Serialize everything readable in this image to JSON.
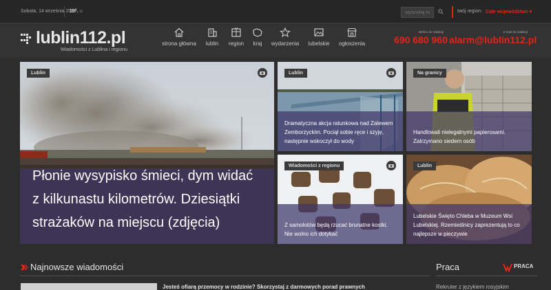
{
  "topbar": {
    "date": "Sobota, 14 września 2019",
    "temperature": "19°.",
    "search_placeholder": "wyszukaj na",
    "region_label": "twój region:",
    "region_value": "Całe województwo ▾"
  },
  "header": {
    "logo": "lublin112.pl",
    "tagline": "Wiadomości z Lublina i regionu",
    "nav": [
      {
        "label": "strona główna",
        "icon": "home-icon"
      },
      {
        "label": "lublin",
        "icon": "building-icon"
      },
      {
        "label": "region",
        "icon": "map-grid-icon"
      },
      {
        "label": "kraj",
        "icon": "country-icon"
      },
      {
        "label": "wydarzenia",
        "icon": "star-icon"
      },
      {
        "label": "lubelskie",
        "icon": "landscape-icon"
      },
      {
        "label": "ogłoszenia",
        "icon": "shop-icon"
      }
    ],
    "phone_label": "telefon do redakcji",
    "phone": "690 680 960",
    "email_label": "e-mail do redakcji",
    "email": "alarm@lublin112.pl"
  },
  "featured": {
    "tag": "Lublin",
    "title": "Płonie wysypisko śmieci, dym widać z kilkunastu kilometrów. Dziesiątki strażaków na miejscu (zdjęcia)"
  },
  "tiles": [
    {
      "tag": "Lublin",
      "title": "Dramatyczna akcja ratunkowa nad Zalewem Zemborzyckim. Pociął sobie ręce i szyję, następnie wskoczył do wody"
    },
    {
      "tag": "Na granicy",
      "title": "Handlowali nielegalnymi papierosami. Zatrzymano siedem osób"
    },
    {
      "tag": "Wiadomości z regionu",
      "title": "Z samolotów będą rzucać brunatne kostki. Nie wolno ich dotykać"
    },
    {
      "tag": "Lublin",
      "title": "Lubelskie Święto Chleba w Muzeum Wsi Lubelskiej. Rzemieślnicy zaprezentują to co najlepsze w pieczywie"
    }
  ],
  "latest": {
    "heading": "Najnowsze wiadomości",
    "first_title": "Jesteś ofiarą przemocy w rodzinie? Skorzystaj z darmowych porad prawnych"
  },
  "jobs": {
    "heading": "Praca",
    "logo": "PRACA",
    "first_title": "Rekruter z językiem rosyjskim"
  },
  "colors": {
    "accent": "#e1251b",
    "caption_overlay": "#3e3668"
  }
}
